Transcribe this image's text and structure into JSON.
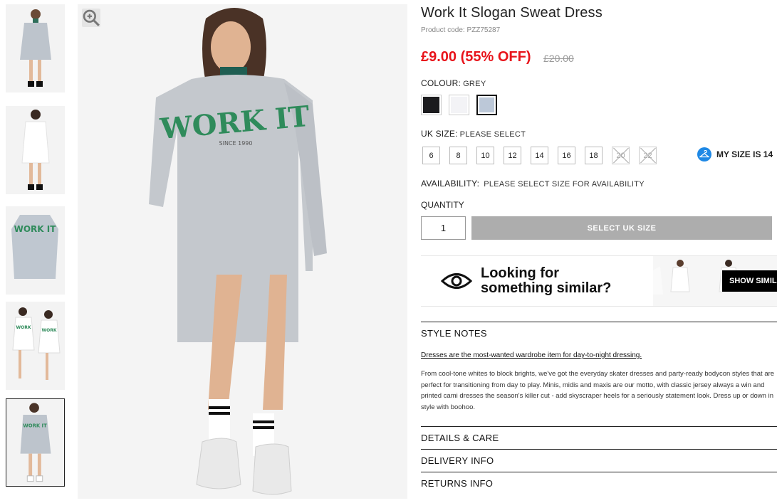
{
  "gallery": {
    "zoom_icon": "zoom-in-icon",
    "thumbnails": [
      "thumb-1",
      "thumb-2",
      "thumb-3",
      "thumb-4",
      "thumb-5"
    ],
    "main_print": "WORK IT",
    "main_print_sub": "SINCE 1990"
  },
  "product": {
    "title": "Work It Slogan Sweat Dress",
    "code": "Product code: PZZ75287",
    "price_now": "£9.00 (55% OFF)",
    "price_was": "£20.00"
  },
  "colour": {
    "label": "COLOUR:",
    "value": "GREY",
    "swatches": [
      {
        "name": "black",
        "hex": "#1b1b1e"
      },
      {
        "name": "white",
        "hex": "#f3f3f6"
      },
      {
        "name": "grey",
        "hex": "#bcc8d8",
        "selected": true
      }
    ]
  },
  "size": {
    "label": "UK SIZE:",
    "value": "PLEASE SELECT",
    "options": [
      {
        "label": "6",
        "available": true
      },
      {
        "label": "8",
        "available": true
      },
      {
        "label": "10",
        "available": true
      },
      {
        "label": "12",
        "available": true
      },
      {
        "label": "14",
        "available": true
      },
      {
        "label": "16",
        "available": true
      },
      {
        "label": "18",
        "available": true
      },
      {
        "label": "20",
        "available": false
      },
      {
        "label": "22",
        "available": false
      }
    ],
    "my_size": "MY SIZE IS 14"
  },
  "availability": {
    "label": "AVAILABILITY:",
    "value": "PLEASE SELECT SIZE FOR AVAILABILITY"
  },
  "quantity": {
    "label": "QUANTITY",
    "value": "1",
    "cta": "SELECT UK SIZE"
  },
  "similar": {
    "line1": "Looking for",
    "line2": "something similar?",
    "button": "SHOW SIMILAR"
  },
  "style_notes": {
    "heading": "STYLE NOTES",
    "lead": "Dresses are the most-wanted wardrobe item for day-to-night dressing.",
    "body": "From cool-tone whites to block brights, we've got the everyday skater dresses and party-ready bodycon styles that are perfect for transitioning from day to play. Minis, midis and maxis are our motto, with classic jersey always a win and printed cami dresses the season's killer cut - add skyscraper heels for a seriously statement look. Dress up or down in style with boohoo."
  },
  "sections": [
    "DETAILS & CARE",
    "DELIVERY INFO",
    "RETURNS INFO"
  ],
  "colors": {
    "sale_red": "#e8141b",
    "cta_grey": "#adadad",
    "print_green": "#2f8b5b",
    "hanger_blue": "#1e88e5"
  }
}
